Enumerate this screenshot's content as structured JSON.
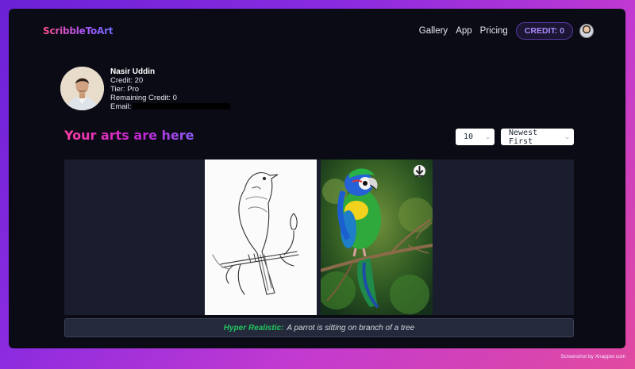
{
  "app": {
    "logo": "ScribbleToArt"
  },
  "nav": {
    "links": [
      "Gallery",
      "App",
      "Pricing"
    ],
    "credit": "CREDIT: 0"
  },
  "profile": {
    "name": "Nasir Uddin",
    "credit": "Credit: 20",
    "tier": "Tier: Pro",
    "remaining": "Remaining Credit: 0",
    "email_label": "Email:"
  },
  "gallery": {
    "title": "Your arts are here",
    "page_size": "10",
    "sort": "Newest First",
    "items": [
      {
        "style": "Hyper Realistic:",
        "prompt": "A parrot is sitting on branch of a tree",
        "download_icon": "download-icon"
      }
    ]
  },
  "watermark": "Screenshot by Xnapper.com",
  "colors": {
    "accent": "#a78bfa",
    "style_label": "#22c55e",
    "background": "#0b0b16"
  }
}
